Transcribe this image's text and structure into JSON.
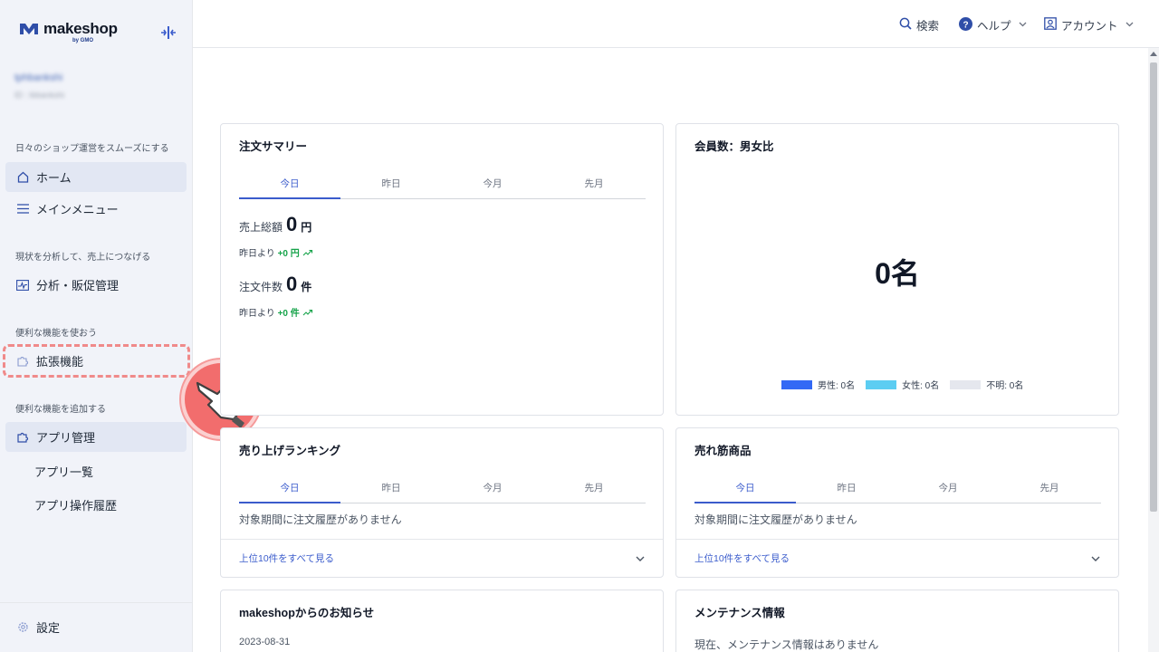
{
  "brand": {
    "name": "makeshop",
    "sub": "by GMO"
  },
  "shop": {
    "name": "tphbankshi",
    "id": "ID : tbbankshi"
  },
  "sidebar": {
    "sections": [
      "日々のショップ運営をスムーズにする",
      "現状を分析して、売上につなげる",
      "便利な機能を使おう",
      "便利な機能を追加する"
    ],
    "items": {
      "home": "ホーム",
      "main_menu": "メインメニュー",
      "analytics": "分析・販促管理",
      "extensions": "拡張機能",
      "apps": "アプリ管理",
      "app_list": "アプリ一覧",
      "app_history": "アプリ操作履歴",
      "settings": "設定"
    }
  },
  "header": {
    "search": "検索",
    "help": "ヘルプ",
    "account": "アカウント"
  },
  "tabs": [
    "今日",
    "昨日",
    "今月",
    "先月"
  ],
  "order_summary": {
    "title": "注文サマリー",
    "sales_label": "売上総額",
    "sales_value": "0",
    "sales_unit": "円",
    "orders_label": "注文件数",
    "orders_value": "0",
    "orders_unit": "件",
    "delta_prefix": "昨日より",
    "sales_delta": "+0 円",
    "orders_delta": "+0 件"
  },
  "members": {
    "title": "会員数：男女比",
    "total": "0名",
    "legend": [
      "男性: 0名",
      "女性: 0名",
      "不明: 0名"
    ],
    "colors": [
      "#3369f5",
      "#5ccdf2",
      "#e5e7ee"
    ]
  },
  "ranking": {
    "title": "売り上げランキング",
    "empty": "対象期間に注文履歴がありません",
    "see_all": "上位10件をすべて見る"
  },
  "bestsellers": {
    "title": "売れ筋商品",
    "empty": "対象期間に注文履歴がありません",
    "see_all": "上位10件をすべて見る"
  },
  "news": {
    "title": "makeshopからのお知らせ",
    "date": "2023-08-31"
  },
  "maintenance": {
    "title": "メンテナンス情報",
    "text": "現在、メンテナンス情報はありません"
  },
  "accent_color": "#3b5ccc"
}
